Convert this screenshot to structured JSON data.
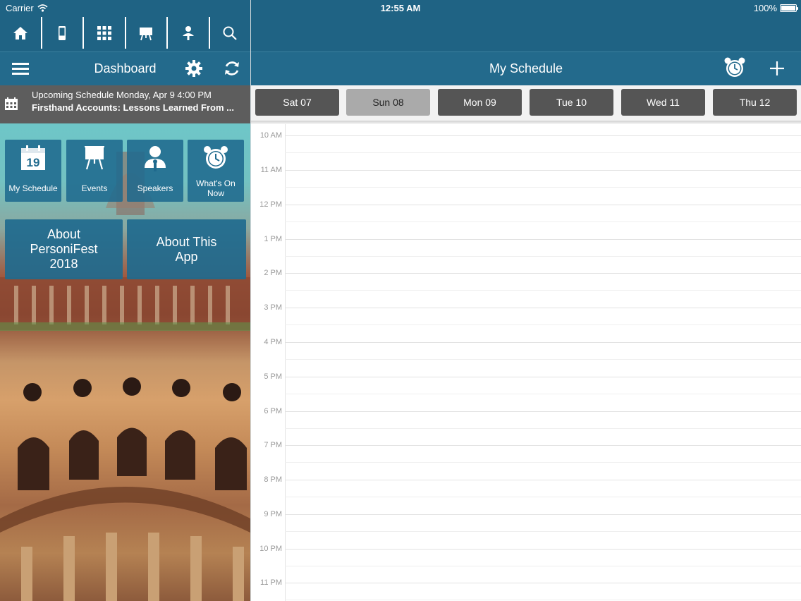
{
  "status_bar": {
    "carrier": "Carrier",
    "time": "12:55 AM",
    "battery": "100%"
  },
  "toolbar": {
    "icons": [
      "home-icon",
      "phone-icon",
      "grid-icon",
      "presentation-icon",
      "speaker-icon",
      "search-icon"
    ]
  },
  "dashboard": {
    "title": "Dashboard",
    "upcoming": {
      "line1": "Upcoming Schedule Monday, Apr 9 4:00 PM",
      "line2": "Firsthand Accounts: Lessons Learned From ..."
    },
    "tiles": [
      {
        "label": "My Schedule",
        "calendar_day": "19"
      },
      {
        "label": "Events"
      },
      {
        "label": "Speakers"
      },
      {
        "label_line1": "What's On",
        "label_line2": "Now"
      }
    ],
    "buttons": [
      {
        "line1": "About",
        "line2": "PersoniFest",
        "line3": "2018"
      },
      {
        "line1": "About This",
        "line2": "App"
      }
    ]
  },
  "schedule": {
    "title": "My Schedule",
    "days": [
      "Sat 07",
      "Sun 08",
      "Mon 09",
      "Tue 10",
      "Wed 11",
      "Thu 12"
    ],
    "selected_day": "Sun 08",
    "times": [
      "10 AM",
      "11 AM",
      "12 PM",
      "1 PM",
      "2 PM",
      "3 PM",
      "4 PM",
      "5 PM",
      "6 PM",
      "7 PM",
      "8 PM",
      "9 PM",
      "10 PM",
      "11 PM"
    ]
  },
  "colors": {
    "toolbar": "#1f6384",
    "nav": "#236a8c",
    "day_button": "#555555",
    "day_button_active": "#aaaaaa",
    "upcoming_bg": "#5d5d5d"
  }
}
